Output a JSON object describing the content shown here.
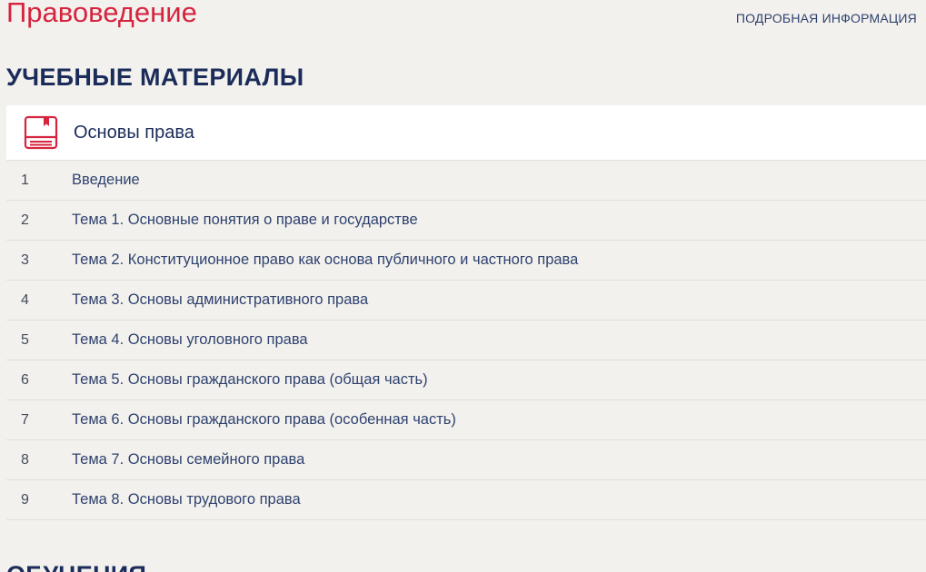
{
  "header": {
    "course_title": "Правоведение",
    "info_link": "ПОДРОБНАЯ ИНФОРМАЦИЯ"
  },
  "materials": {
    "section_title": "УЧЕБНЫЕ МАТЕРИАЛЫ",
    "module": {
      "title": "Основы права",
      "icon": "book-icon",
      "lessons": [
        {
          "num": "1",
          "title": "Введение"
        },
        {
          "num": "2",
          "title": "Тема 1. Основные понятия о праве и государстве"
        },
        {
          "num": "3",
          "title": "Тема 2. Конституционное право как основа публичного и частного права"
        },
        {
          "num": "4",
          "title": "Тема 3. Основы административного права"
        },
        {
          "num": "5",
          "title": "Тема 4. Основы уголовного права"
        },
        {
          "num": "6",
          "title": "Тема 5. Основы гражданского права (общая часть)"
        },
        {
          "num": "7",
          "title": "Тема 6. Основы гражданского права (особенная часть)"
        },
        {
          "num": "8",
          "title": "Тема 7. Основы семейного права"
        },
        {
          "num": "9",
          "title": "Тема 8. Основы трудового права"
        }
      ]
    }
  },
  "next_section": {
    "title": "ОБУЧЕНИЯ"
  },
  "colors": {
    "accent_red": "#d6243f",
    "navy": "#1b2c5a",
    "link": "#2e4270",
    "background": "#f3f1ed"
  }
}
